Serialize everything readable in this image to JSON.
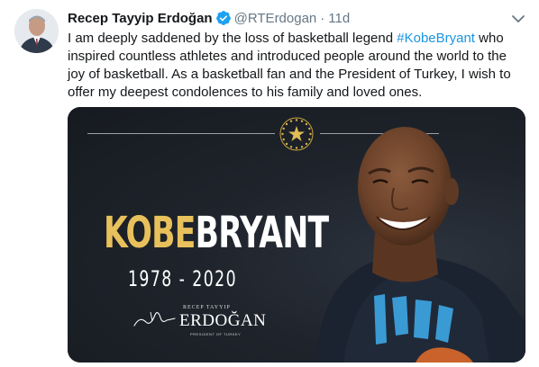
{
  "tweet": {
    "author_name": "Recep Tayyip Erdoğan",
    "handle": "@RTErdogan",
    "separator": "·",
    "time": "11d",
    "text_before": "I am deeply saddened by the loss of basketball legend ",
    "hashtag": "#KobeBryant",
    "text_after": " who inspired countless athletes and introduced people around the world to the joy of basketball. As a basketball fan and the President of Turkey, I wish to offer my deepest condolences to his family and loved ones."
  },
  "media": {
    "title_part1": "KOBE",
    "title_part2": "BRYANT",
    "years": "1978  -  2020",
    "signature_top": "RECEP TAYYIP",
    "signature_name": "ERDOĞAN",
    "signature_sub": "PRESIDENT OF TURKEY"
  },
  "icons": {
    "verified": "verified-badge-icon",
    "chevron": "chevron-down-icon",
    "seal": "presidential-seal-icon"
  },
  "colors": {
    "hashtag": "#1b95e0",
    "muted": "#657786",
    "verified": "#1da1f2",
    "kobe_gold": "#e8c15c",
    "media_bg": "#1c2129"
  }
}
